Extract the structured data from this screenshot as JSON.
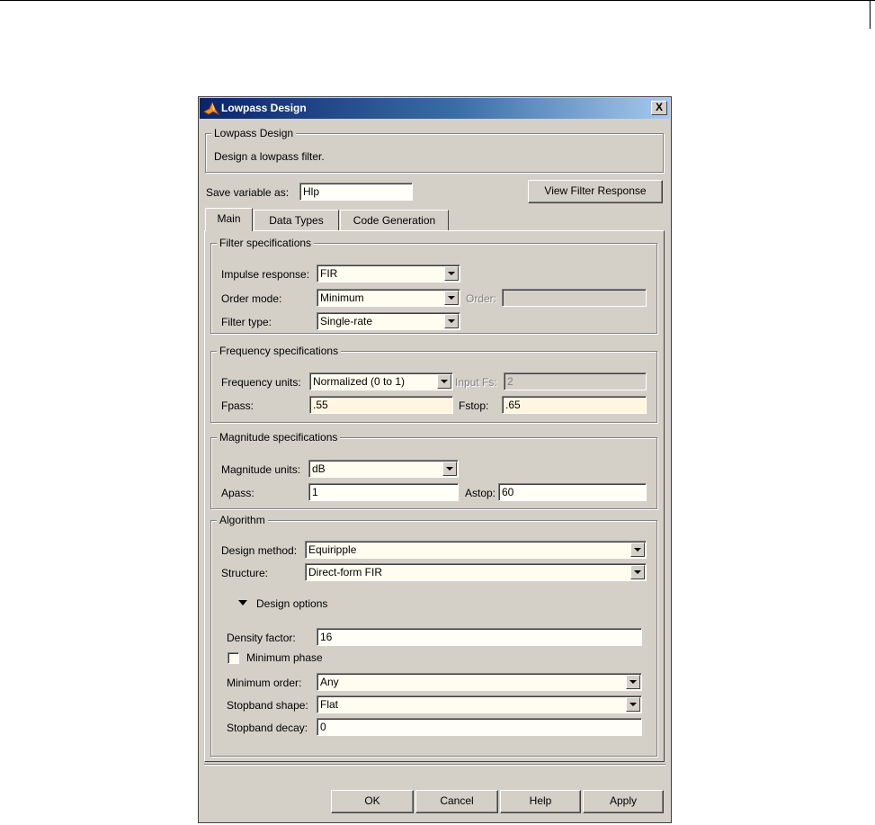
{
  "window": {
    "title": "Lowpass Design",
    "close_label": "X"
  },
  "header": {
    "group_title": "Lowpass Design",
    "description": "Design a lowpass filter."
  },
  "save_variable": {
    "label": "Save variable as:",
    "value": "Hlp"
  },
  "view_button": "View Filter Response",
  "tabs": [
    {
      "label": "Main",
      "active": true
    },
    {
      "label": "Data Types",
      "active": false
    },
    {
      "label": "Code Generation",
      "active": false
    }
  ],
  "filter_spec": {
    "title": "Filter specifications",
    "impulse_label": "Impulse response:",
    "impulse_value": "FIR",
    "order_mode_label": "Order mode:",
    "order_mode_value": "Minimum",
    "order_label": "Order:",
    "order_value": "",
    "filter_type_label": "Filter type:",
    "filter_type_value": "Single-rate"
  },
  "freq_spec": {
    "title": "Frequency specifications",
    "units_label": "Frequency units:",
    "units_value": "Normalized (0 to 1)",
    "input_fs_label": "Input Fs:",
    "input_fs_value": "2",
    "fpass_label": "Fpass:",
    "fpass_value": ".55",
    "fstop_label": "Fstop:",
    "fstop_value": ".65"
  },
  "mag_spec": {
    "title": "Magnitude specifications",
    "units_label": "Magnitude units:",
    "units_value": "dB",
    "apass_label": "Apass:",
    "apass_value": "1",
    "astop_label": "Astop:",
    "astop_value": "60"
  },
  "algorithm": {
    "title": "Algorithm",
    "method_label": "Design method:",
    "method_value": "Equiripple",
    "structure_label": "Structure:",
    "structure_value": "Direct-form FIR",
    "options_label": "Design options",
    "density_label": "Density factor:",
    "density_value": "16",
    "min_phase_label": "Minimum phase",
    "min_phase_checked": false,
    "min_order_label": "Minimum order:",
    "min_order_value": "Any",
    "stopband_shape_label": "Stopband shape:",
    "stopband_shape_value": "Flat",
    "stopband_decay_label": "Stopband decay:",
    "stopband_decay_value": "0"
  },
  "footer": {
    "ok": "OK",
    "cancel": "Cancel",
    "help": "Help",
    "apply": "Apply"
  },
  "colors": {
    "dialog_bg": "#d4d0c8",
    "title_start": "#0a246a",
    "title_end": "#a6caf0",
    "field_bg": "#fffcf0"
  }
}
